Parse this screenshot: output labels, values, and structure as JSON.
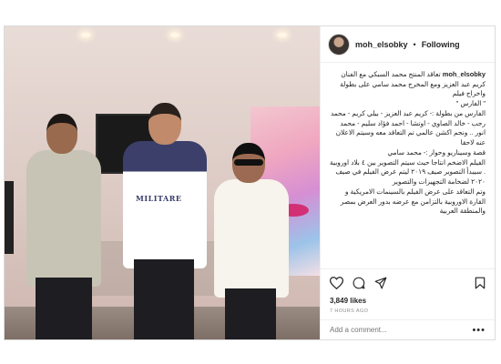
{
  "post": {
    "username": "moh_elsobky",
    "separator": "•",
    "follow_label": "Following",
    "shirt_text": "MILITARE",
    "caption": {
      "user": "moh_elsobky",
      "text": "تعاقد المنتج محمد السبكي مع الفنان كريم عبد العزيز ومع المخرج محمد سامي على بطولة واخراج فيلم\n\" الفارس \"\nالفارس من بطولة :- كريم عبد العزيز - بيلي كريم - محمد رجب - خالد الصاوي - اوتشا - احمد فؤاد سليم - محمد انور .. ونجم اكشن عالمي تم التعاقد معه وسيتم الاعلان عنه لاحقا\nقصة وسيناريو وحوار :- محمد سامي\nالفيلم الاضخم انتاجا حيث سيتم التصوير بين ٤ بلاد اوروبية . سيبدأ التصوير صيف ٢٠١٩ ليتم عرض الفيلم في صيف ٢٠٢٠ لضخامة التجهيزات والتصوير\nوتم التعاقد على عرض الفيلم بالسينمات الامريكية و القارة الاوروبية بالتزامن مع عرضه بدور العرض بمصر والمنطقة العربية"
    },
    "likes": "3,849 likes",
    "time": "7 HOURS AGO",
    "comment_placeholder": "Add a comment...",
    "more_options": "•••"
  },
  "icons": {
    "like": "heart-icon",
    "comment": "comment-icon",
    "share": "share-icon",
    "save": "bookmark-icon"
  }
}
